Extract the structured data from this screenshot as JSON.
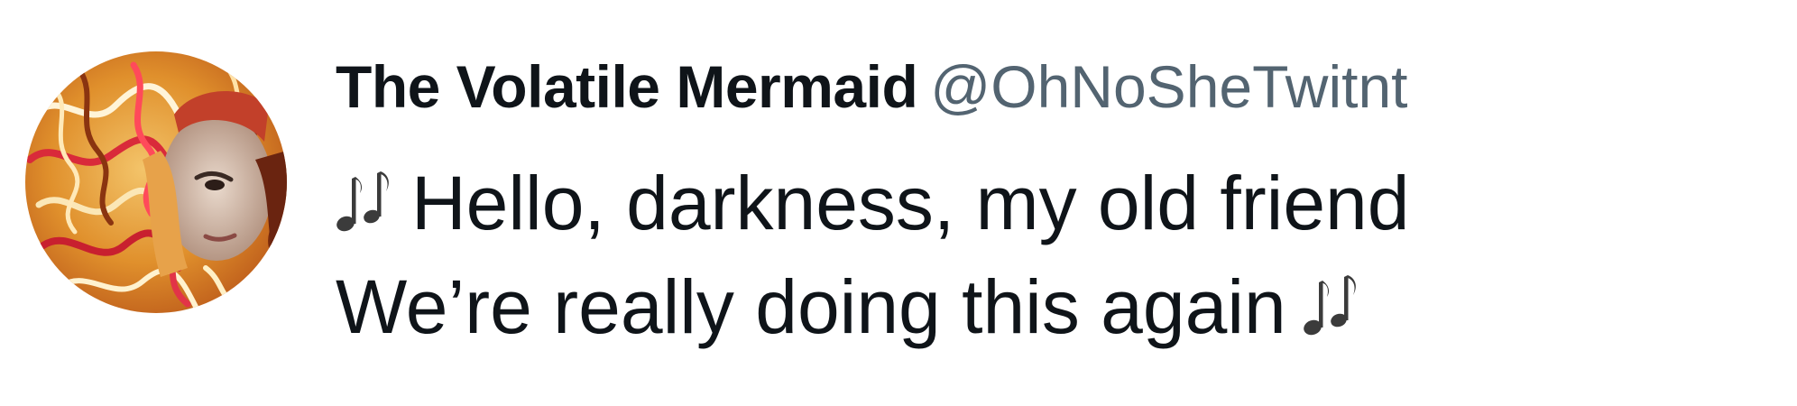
{
  "tweet": {
    "display_name": "The Volatile Mermaid",
    "handle": "@OhNoSheTwitnt",
    "lines": [
      "Hello, darkness, my old friend",
      "We’re really doing this again"
    ],
    "icons": {
      "avatar": "profile-photo",
      "emoji": "musical-notes-icon"
    },
    "colors": {
      "name": "#0f1419",
      "handle": "#536471",
      "text": "#0f1419",
      "background": "#ffffff"
    }
  }
}
